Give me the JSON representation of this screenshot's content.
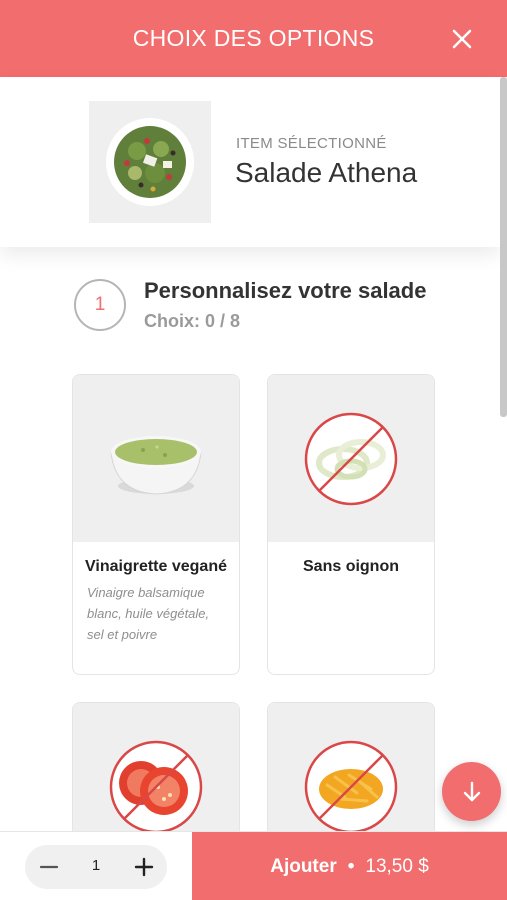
{
  "header": {
    "title": "CHOIX DES OPTIONS",
    "close_icon": "close-icon"
  },
  "selected_item": {
    "caption": "ITEM SÉLECTIONNÉ",
    "name": "Salade Athena"
  },
  "step": {
    "number": "1",
    "title": "Personnalisez votre salade",
    "choices": "Choix: 0 / 8"
  },
  "options": [
    {
      "name": "Vinaigrette vegané",
      "description": "Vinaigre balsamique blanc, huile végétale, sel et poivre",
      "icon": "dressing-bowl-icon"
    },
    {
      "name": "Sans oignon",
      "description": "",
      "icon": "no-onion-icon"
    },
    {
      "name": "",
      "description": "",
      "icon": "no-tomato-icon"
    },
    {
      "name": "",
      "description": "",
      "icon": "no-cheese-icon"
    }
  ],
  "footer": {
    "quantity": "1",
    "add_label": "Ajouter",
    "separator": "•",
    "price": "13,50 $"
  },
  "colors": {
    "accent": "#f26d6d",
    "panel": "#efefef",
    "no_symbol": "#d94747"
  }
}
